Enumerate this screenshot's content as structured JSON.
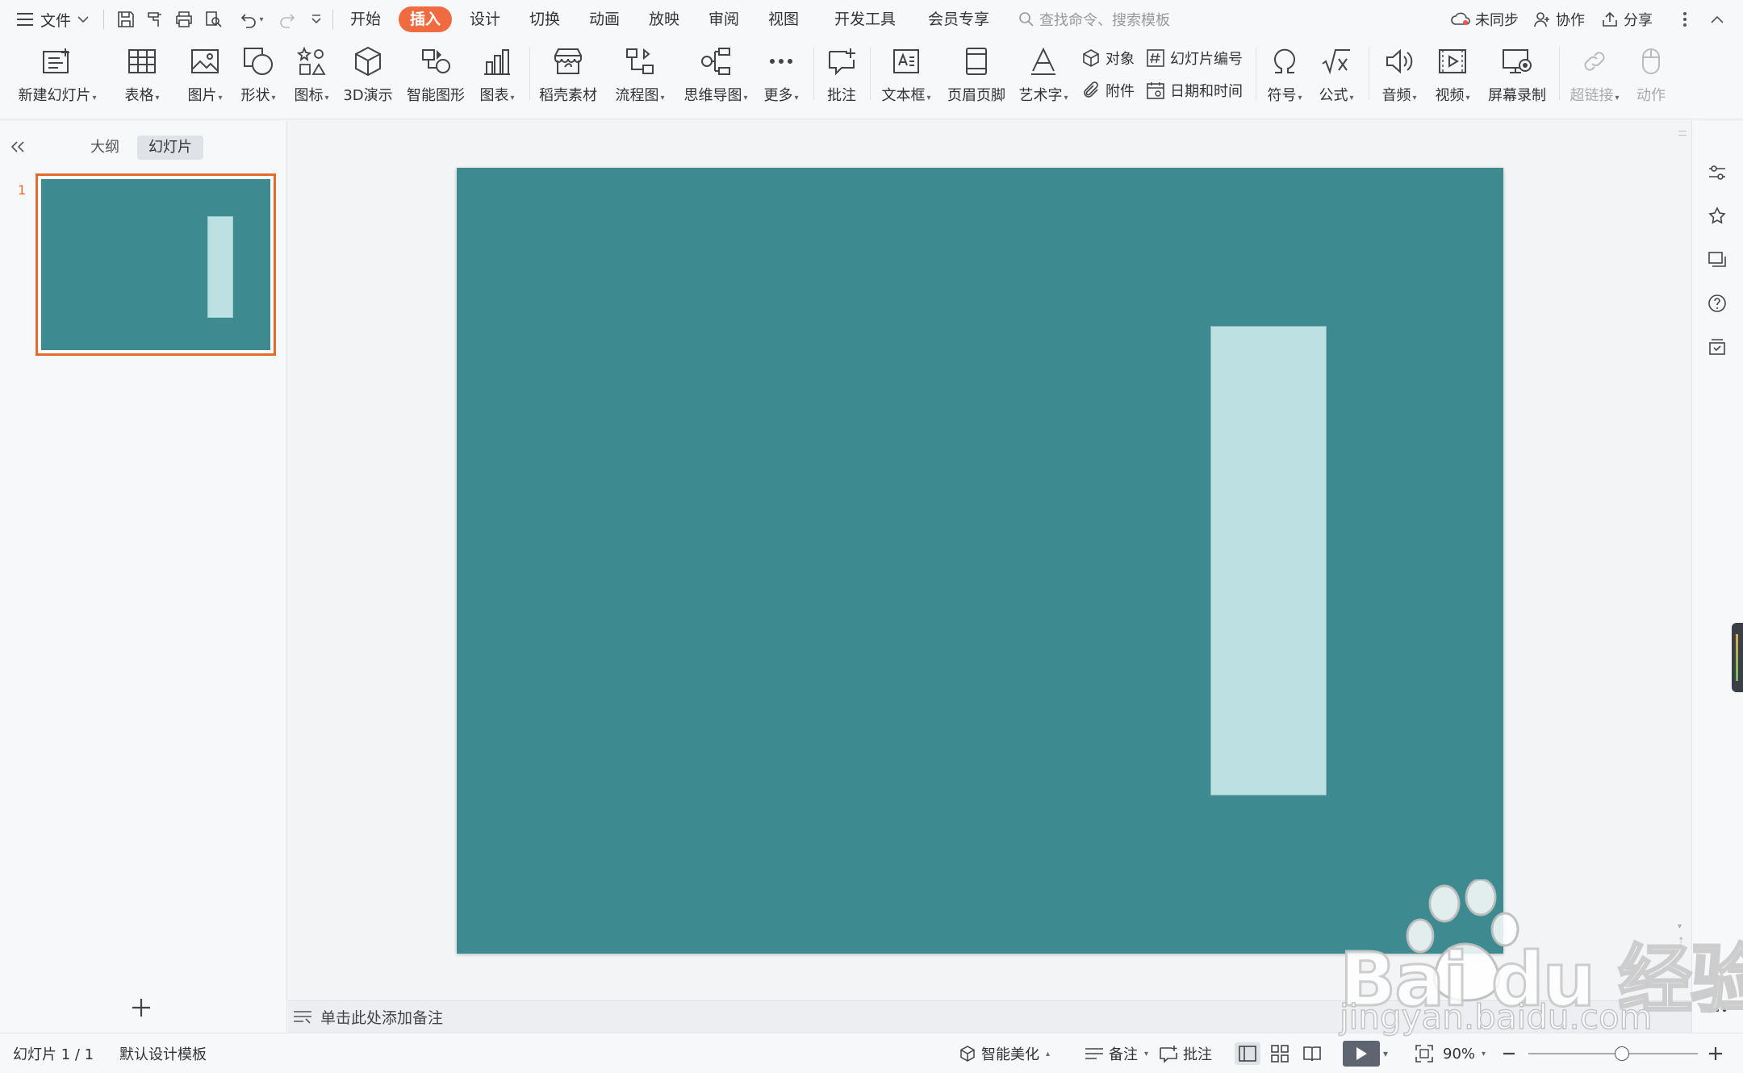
{
  "menubar": {
    "file_label": "文件",
    "tabs": [
      {
        "label": "开始"
      },
      {
        "label": "插入",
        "active": true
      },
      {
        "label": "设计"
      },
      {
        "label": "切换"
      },
      {
        "label": "动画"
      },
      {
        "label": "放映"
      },
      {
        "label": "审阅"
      },
      {
        "label": "视图"
      },
      {
        "label": "开发工具"
      },
      {
        "label": "会员专享"
      }
    ],
    "search_placeholder": "查找命令、搜索模板",
    "sync_label": "未同步",
    "collab_label": "协作",
    "share_label": "分享"
  },
  "ribbon": {
    "new_slide": "新建幻灯片",
    "table": "表格",
    "picture": "图片",
    "shape": "形状",
    "icon": "图标",
    "demo3d": "3D演示",
    "smartart": "智能图形",
    "chart": "图表",
    "material": "稻壳素材",
    "flowchart": "流程图",
    "mindmap": "思维导图",
    "more": "更多",
    "comment": "批注",
    "textbox": "文本框",
    "header_footer": "页眉页脚",
    "wordart": "艺术字",
    "object": "对象",
    "slide_number": "幻灯片编号",
    "attachment": "附件",
    "datetime": "日期和时间",
    "symbol": "符号",
    "formula": "公式",
    "audio": "音频",
    "video": "视频",
    "screen_record": "屏幕录制",
    "hyperlink": "超链接",
    "action": "动作"
  },
  "leftpanel": {
    "tab_outline": "大纲",
    "tab_slides": "幻灯片",
    "slide_index": "1",
    "add_symbol": "+"
  },
  "notes": {
    "placeholder": "单击此处添加备注"
  },
  "statusbar": {
    "slide_count": "幻灯片 1 / 1",
    "template": "默认设计模板",
    "beautify": "智能美化",
    "notes": "备注",
    "comment": "批注",
    "zoom": "90%",
    "zoom_level": 0.55
  },
  "colors": {
    "accent": "#f06b3f",
    "slide_bg": "#3d8a90",
    "rect_fill": "#bde0e3",
    "thumb_border": "#e56a2e"
  },
  "watermark": {
    "brand": "Bai du 经验",
    "url": "jingyan.baidu.com"
  }
}
